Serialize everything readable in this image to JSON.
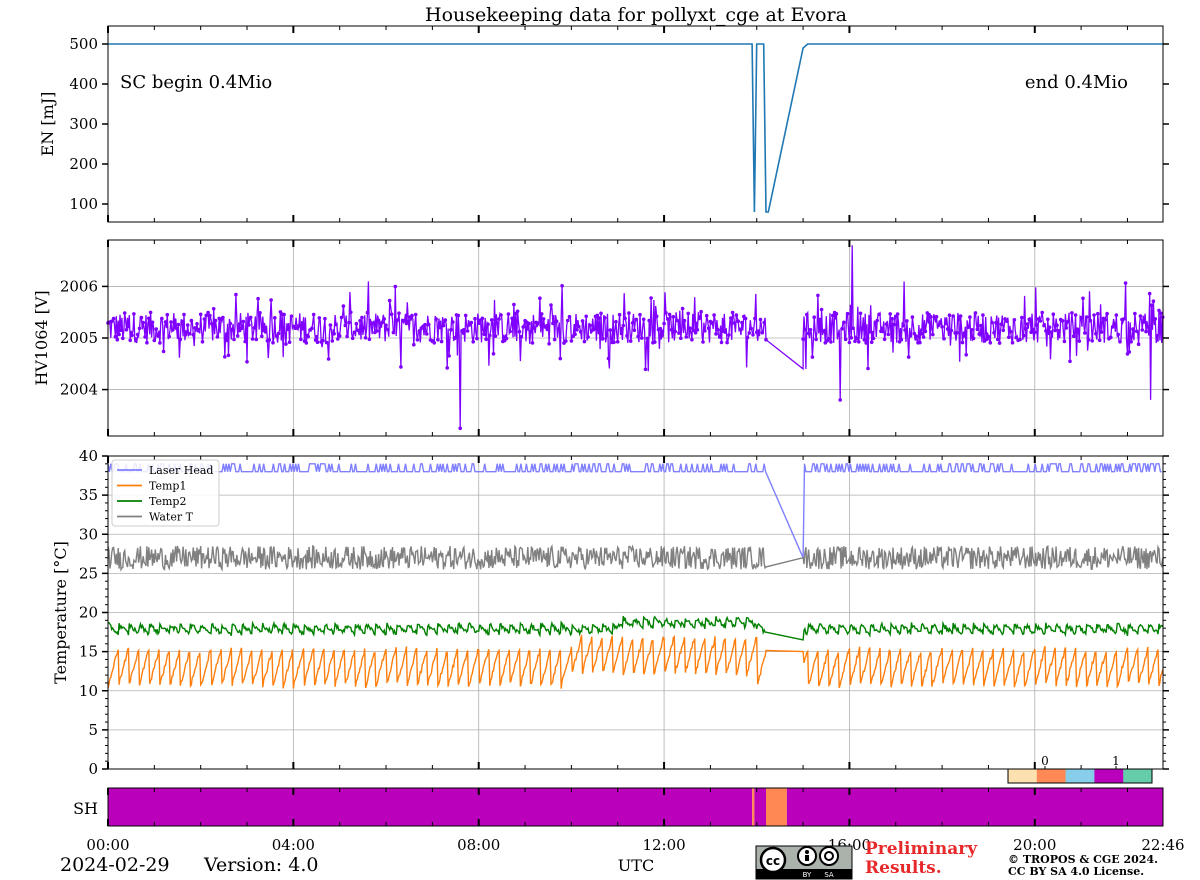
{
  "title": "Housekeeping data for pollyxt_cge at Evora",
  "annotations": {
    "sc_begin": "SC begin 0.4Mio",
    "sc_end": "end 0.4Mio"
  },
  "footer": {
    "date": "2024-02-29",
    "version": "Version: 4.0",
    "xlabel": "UTC",
    "preliminary_line1": "Preliminary",
    "preliminary_line2": "Results.",
    "copyright_line1": "© TROPOS & CGE 2024.",
    "copyright_line2": "CC BY SA 4.0 License.",
    "license_badge_left": "BY",
    "license_badge_right": "SA",
    "preliminary_color": "#e8292b"
  },
  "chart_data": [
    {
      "type": "line",
      "name": "energy-panel",
      "ylabel": "EN [mJ]",
      "xlim": [
        0,
        22.767
      ],
      "ylim": [
        55,
        545
      ],
      "yticks": [
        100,
        200,
        300,
        400,
        500
      ],
      "grid": false,
      "color": "#1f77b4",
      "series": [
        {
          "x": [
            0,
            13.9,
            13.95,
            14.0,
            14.15,
            14.2,
            14.25,
            15.0,
            15.1,
            22.767
          ],
          "y": [
            500,
            500,
            80,
            500,
            500,
            80,
            80,
            490,
            500,
            500
          ]
        }
      ]
    },
    {
      "type": "line",
      "name": "hv1064-panel",
      "ylabel": "HV1064 [V]",
      "xlim": [
        0,
        22.767
      ],
      "ylim": [
        2003.1,
        2006.9
      ],
      "yticks": [
        2004,
        2005,
        2006
      ],
      "grid": true,
      "color": "#7f00ff",
      "series": [
        {
          "x_start": 0.0,
          "x_end": 14.2,
          "mean": 2005.2,
          "noise": 0.3,
          "gap_to": 15.0,
          "gap_value": 2004.4
        },
        {
          "x_start": 15.0,
          "x_end": 22.767,
          "mean": 2005.2,
          "noise": 0.3
        }
      ],
      "spikes": [
        {
          "x": 7.6,
          "y": 2003.25
        },
        {
          "x": 15.8,
          "y": 2003.8
        },
        {
          "x": 16.05,
          "y": 2006.8
        },
        {
          "x": 22.5,
          "y": 2003.8
        }
      ]
    },
    {
      "type": "line",
      "name": "temperature-panel",
      "ylabel": "Temperature [$^\\circ C$]",
      "xlim": [
        0,
        22.767
      ],
      "ylim": [
        0,
        40
      ],
      "yticks": [
        0,
        5,
        10,
        15,
        20,
        25,
        30,
        35,
        40
      ],
      "grid": true,
      "legend": "top-left",
      "series": [
        {
          "name": "Laser Head",
          "color": "#7f7fff",
          "base": 38.0,
          "high": 39.0,
          "gap_value": 27.0,
          "gap_from": 14.2,
          "gap_to": 15.0
        },
        {
          "name": "Temp1",
          "color": "#ff7f0e",
          "base": 12.5,
          "amp": 2.5,
          "gap_value": 15.0,
          "gap_from": 14.2,
          "gap_to": 15.0
        },
        {
          "name": "Temp2",
          "color": "#008000",
          "base": 18.0,
          "amp": 0.8,
          "gap_value": 16.5,
          "gap_from": 14.2,
          "gap_to": 15.0
        },
        {
          "name": "Water T",
          "color": "#808080",
          "base": 27.0,
          "amp": 1.5,
          "gap_value": 27.0,
          "gap_from": 14.2,
          "gap_to": 15.0
        }
      ]
    },
    {
      "type": "heatmap",
      "name": "shutter-panel",
      "ylabel": "SH",
      "xlim": [
        0,
        22.767
      ],
      "colorbar_ticks": [
        "0",
        "1"
      ],
      "colorbar_colors": [
        "#fce0b0",
        "#ff8855",
        "#87ceeb",
        "#bb00bb",
        "#66cdaa"
      ],
      "segments": [
        {
          "from": 0.0,
          "to": 13.9,
          "color": "#bb00bb"
        },
        {
          "from": 13.9,
          "to": 13.95,
          "color": "#ff8855"
        },
        {
          "from": 13.95,
          "to": 14.2,
          "color": "#bb00bb"
        },
        {
          "from": 14.2,
          "to": 14.65,
          "color": "#ff8855"
        },
        {
          "from": 14.65,
          "to": 22.767,
          "color": "#bb00bb"
        }
      ]
    }
  ],
  "xticks": [
    "00:00",
    "04:00",
    "08:00",
    "12:00",
    "16:00",
    "20:00",
    "22:46"
  ],
  "xtick_values": [
    0,
    4,
    8,
    12,
    16,
    20,
    22.767
  ]
}
